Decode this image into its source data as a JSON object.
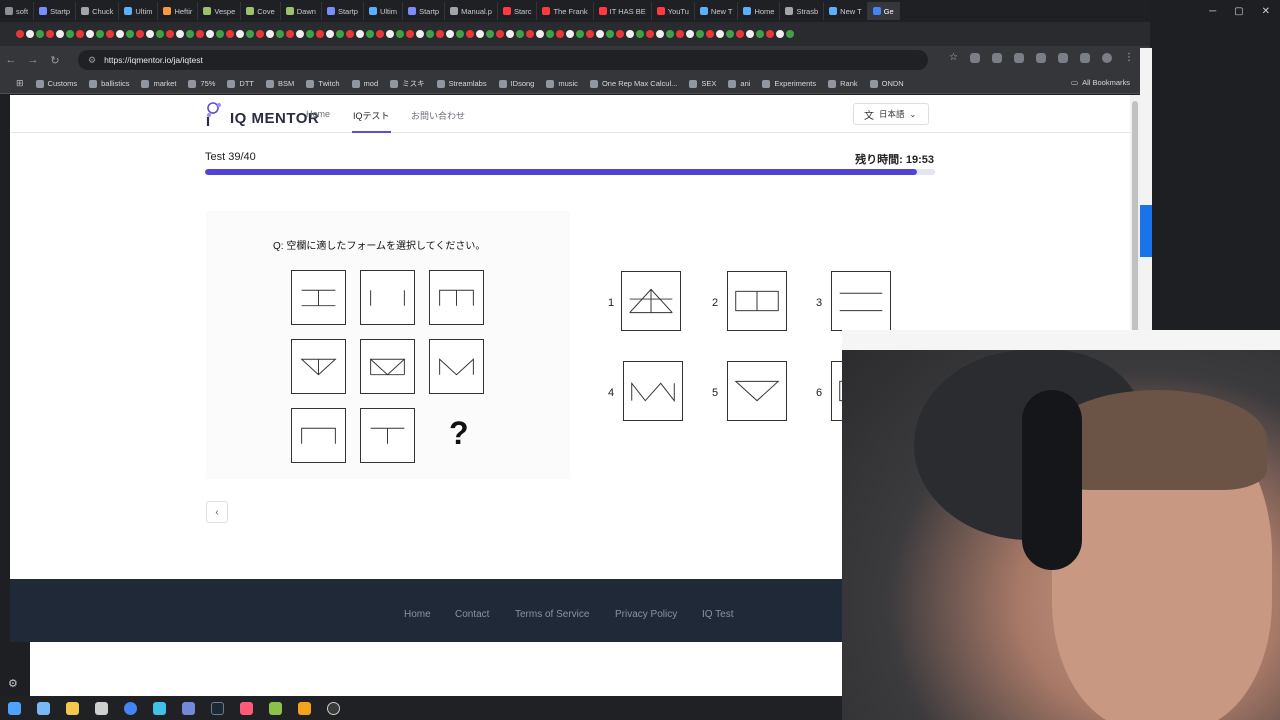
{
  "browser": {
    "tabs": [
      {
        "label": "soft",
        "color": "#8a8f98"
      },
      {
        "label": "Startp",
        "color": "#7c8cff"
      },
      {
        "label": "Chuck",
        "color": "#a0a4ab"
      },
      {
        "label": "Ultim",
        "color": "#5ab0ff"
      },
      {
        "label": "Heftir",
        "color": "#ff9a3c"
      },
      {
        "label": "Vespe",
        "color": "#9cc26b"
      },
      {
        "label": "Cove",
        "color": "#9cc26b"
      },
      {
        "label": "Dawn",
        "color": "#9cc26b"
      },
      {
        "label": "Startp",
        "color": "#7c8cff"
      },
      {
        "label": "Ultim",
        "color": "#5ab0ff"
      },
      {
        "label": "Startp",
        "color": "#7c8cff"
      },
      {
        "label": "Manual.p",
        "color": "#a0a4ab"
      },
      {
        "label": "Starc",
        "color": "#ff3b3b"
      },
      {
        "label": "The Frank",
        "color": "#ff3b3b"
      },
      {
        "label": "IT HAS BE",
        "color": "#ff3b3b"
      },
      {
        "label": "YouTu",
        "color": "#ff3b3b"
      },
      {
        "label": "New T",
        "color": "#5ab0ff"
      },
      {
        "label": "Home",
        "color": "#5ab0ff"
      },
      {
        "label": "Strasb",
        "color": "#a0a4ab"
      },
      {
        "label": "New T",
        "color": "#5ab0ff"
      },
      {
        "label": "Ge",
        "color": "#4285f4",
        "active": true
      }
    ],
    "url": "https://iqmentor.io/ja/iqtest",
    "bookmarks": [
      "Customs",
      "ballistics",
      "market",
      "75%",
      "DTT",
      "BSM",
      "Twitch",
      "mod",
      "ミスキ",
      "Streamlabs",
      "IDsong",
      "music",
      "One Rep Max Calcul...",
      "SEX",
      "ani",
      "Experiments",
      "Rank",
      "ONDN"
    ],
    "all_bookmarks": "All Bookmarks"
  },
  "site": {
    "logo": "IQ MENTOR",
    "nav": {
      "home": "Home",
      "iqtest": "IQテスト",
      "contact": "お問い合わせ"
    },
    "language": "日本語"
  },
  "test": {
    "count": "Test 39/40",
    "timer": "残り時間: 19:53",
    "progress": 0.975,
    "question": "Q: 空欄に適したフォームを選択してください。",
    "missing": "?",
    "options": [
      "1",
      "2",
      "3",
      "4",
      "5",
      "6"
    ],
    "prev": "‹",
    "next": "›"
  },
  "footer": {
    "links": [
      "Home",
      "Contact",
      "Terms of Service",
      "Privacy Policy",
      "IQ Test"
    ]
  },
  "colors": {
    "accent": "#5044d4",
    "footer_bg": "#1f2937"
  }
}
